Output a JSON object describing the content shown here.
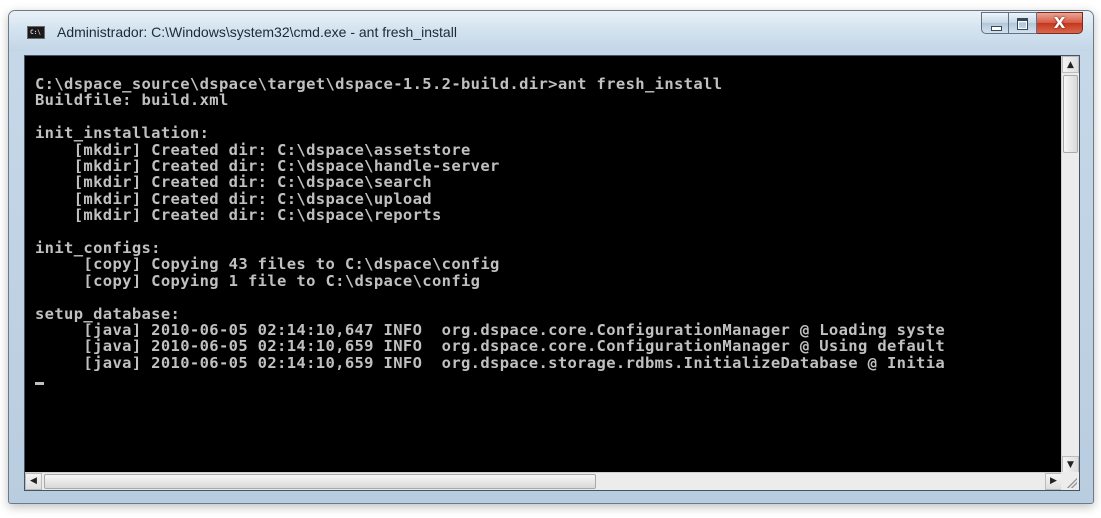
{
  "window": {
    "title": "Administrador: C:\\Windows\\system32\\cmd.exe - ant  fresh_install",
    "icon": "cmd-icon",
    "icon_text": "C:\\",
    "controls": {
      "minimize_icon": "minimize-icon",
      "maximize_icon": "maximize-icon",
      "close_glyph": "X"
    }
  },
  "console": {
    "background": "#000000",
    "foreground": "#c0c0c0",
    "lines": [
      "C:\\dspace_source\\dspace\\target\\dspace-1.5.2-build.dir>ant fresh_install",
      "Buildfile: build.xml",
      "",
      "init_installation:",
      "    [mkdir] Created dir: C:\\dspace\\assetstore",
      "    [mkdir] Created dir: C:\\dspace\\handle-server",
      "    [mkdir] Created dir: C:\\dspace\\search",
      "    [mkdir] Created dir: C:\\dspace\\upload",
      "    [mkdir] Created dir: C:\\dspace\\reports",
      "",
      "init_configs:",
      "     [copy] Copying 43 files to C:\\dspace\\config",
      "     [copy] Copying 1 file to C:\\dspace\\config",
      "",
      "setup_database:",
      "     [java] 2010-06-05 02:14:10,647 INFO  org.dspace.core.ConfigurationManager @ Loading syste",
      "     [java] 2010-06-05 02:14:10,659 INFO  org.dspace.core.ConfigurationManager @ Using default",
      "     [java] 2010-06-05 02:14:10,659 INFO  org.dspace.storage.rdbms.InitializeDatabase @ Initia"
    ]
  },
  "scrollbars": {
    "up_glyph": "▲",
    "down_glyph": "▼",
    "left_glyph": "◀",
    "right_glyph": "▶"
  }
}
